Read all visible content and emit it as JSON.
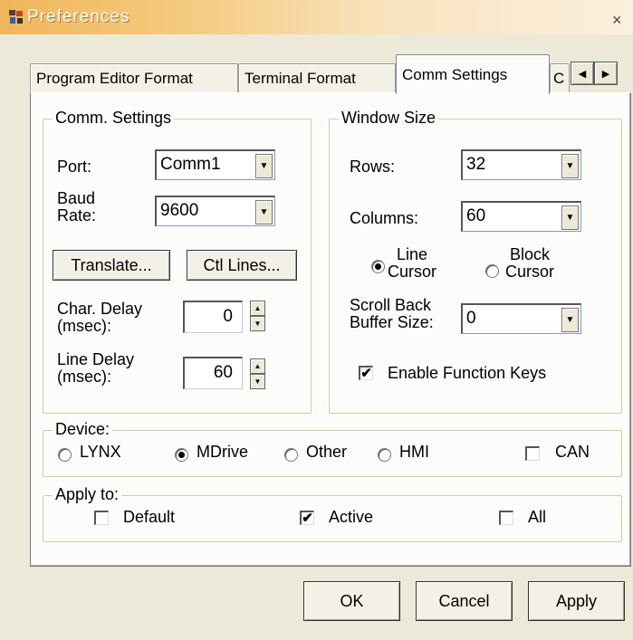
{
  "window": {
    "title": "Preferences",
    "close_glyph": "×",
    "icon": "app-icon"
  },
  "tabs": [
    {
      "label": "Program Editor Format"
    },
    {
      "label": "Terminal Format"
    },
    {
      "label": "Comm Settings",
      "active": true
    },
    {
      "label": "C"
    }
  ],
  "tab_scroll": {
    "left_glyph": "◀",
    "right_glyph": "▶"
  },
  "comm": {
    "title": "Comm. Settings",
    "port_label": "Port:",
    "port_value": "Comm1",
    "baud_label": "Baud\nRate:",
    "baud_value": "9600",
    "translate_label": "Translate...",
    "ctl_lines_label": "Ctl Lines...",
    "char_delay_label": "Char. Delay\n(msec):",
    "char_delay_value": "0",
    "line_delay_label": "Line Delay\n(msec):",
    "line_delay_value": "60"
  },
  "window_size": {
    "title": "Window Size",
    "rows_label": "Rows:",
    "rows_value": "32",
    "columns_label": "Columns:",
    "columns_value": "60",
    "line_cursor_label": "Line\nCursor",
    "block_cursor_label": "Block\nCursor",
    "cursor_selected": "line",
    "scroll_label": "Scroll Back\nBuffer Size:",
    "scroll_value": "0",
    "fn_keys_label": "Enable Function Keys",
    "fn_keys_checked": true
  },
  "device": {
    "title": "Device:",
    "options": [
      "LYNX",
      "MDrive",
      "Other",
      "HMI"
    ],
    "selected": "MDrive",
    "can_label": "CAN",
    "can_checked": false
  },
  "apply_to": {
    "title": "Apply to:",
    "default_label": "Default",
    "default_checked": false,
    "active_label": "Active",
    "active_checked": true,
    "all_label": "All",
    "all_checked": false
  },
  "buttons": {
    "ok": "OK",
    "cancel": "Cancel",
    "apply": "Apply"
  },
  "colors": {
    "dialog_bg": "#ECE9D8",
    "panel_bg": "#FCFCFA",
    "title_bar": "#F0B658"
  }
}
